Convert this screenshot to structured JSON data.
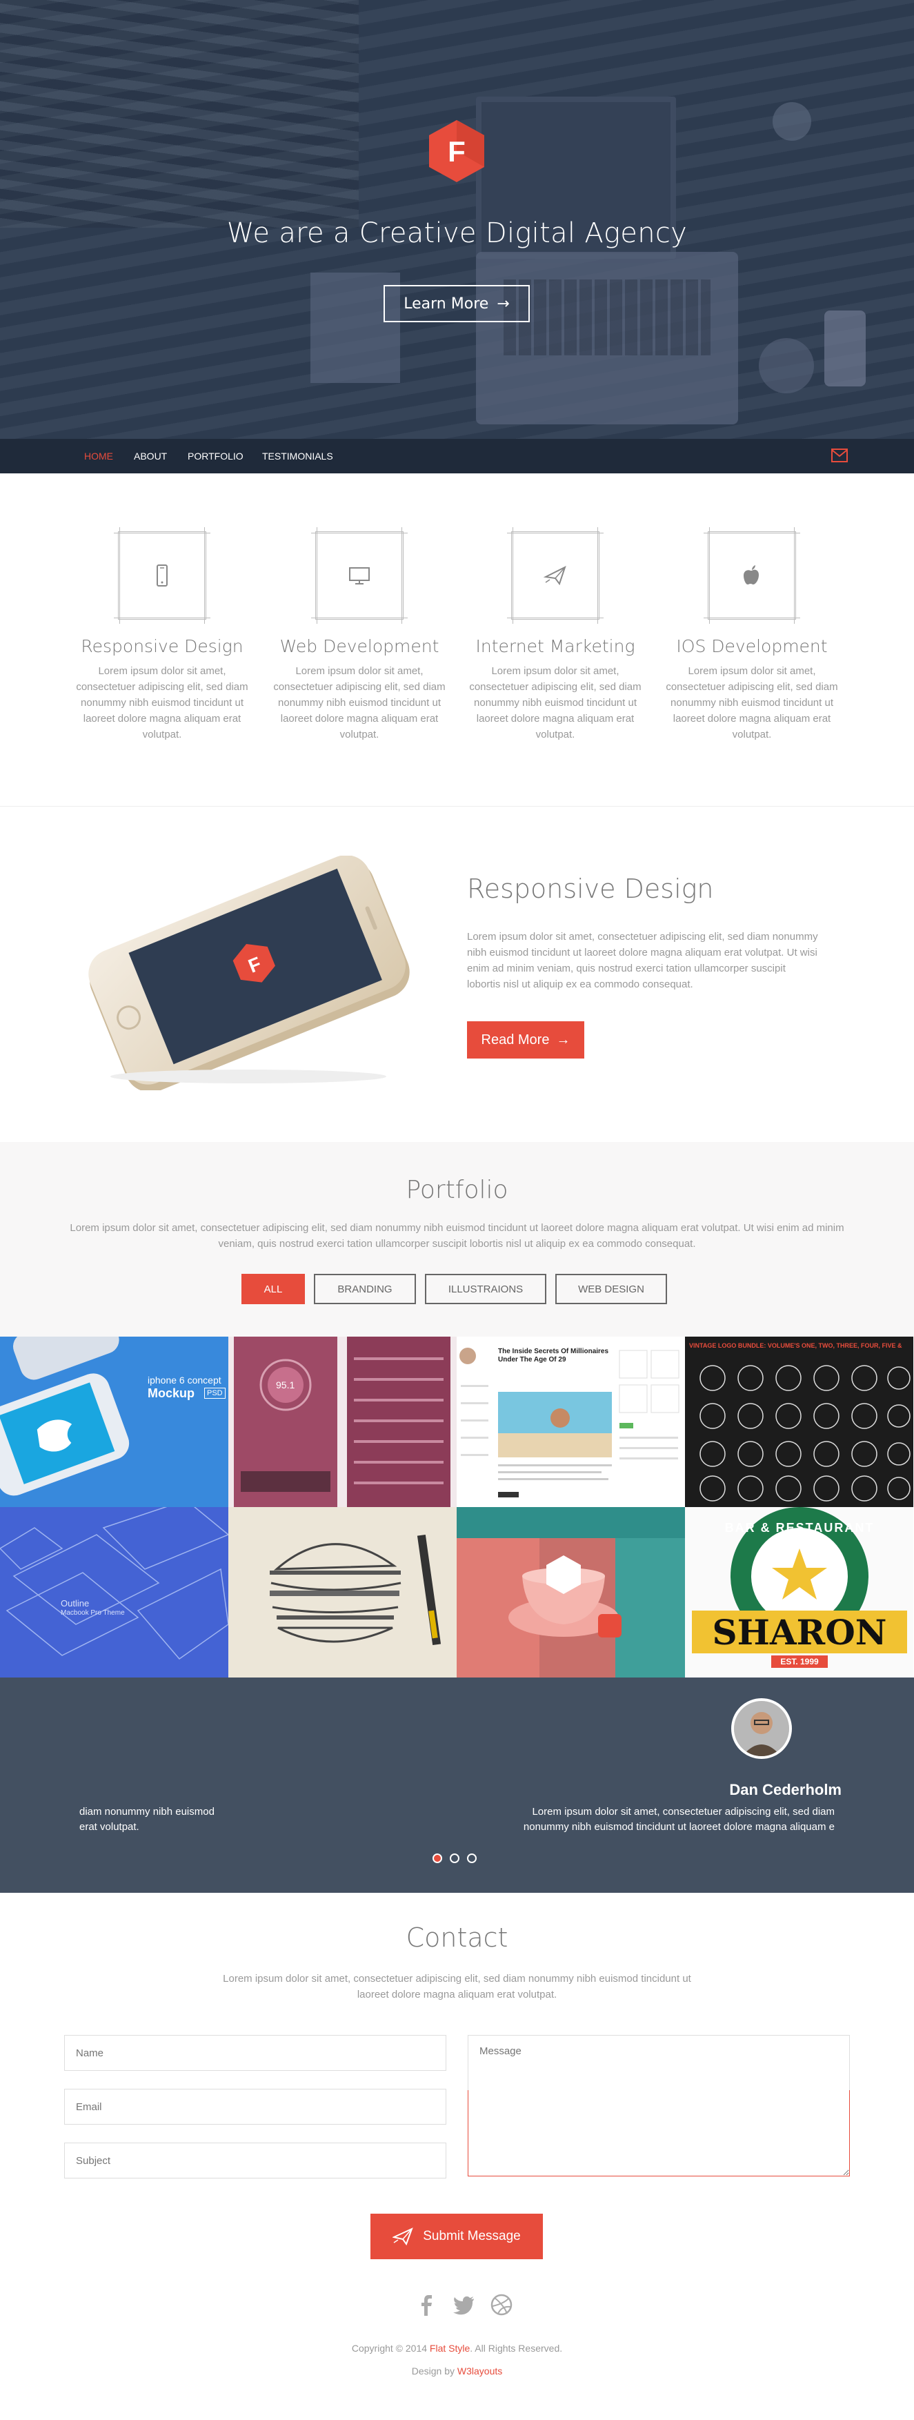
{
  "hero": {
    "logo_letter": "F",
    "title": "We are a Creative Digital Agency",
    "button_label": "Learn More",
    "button_arrow": "→"
  },
  "nav": {
    "items": [
      "HOME",
      "ABOUT",
      "PORTFOLIO",
      "TESTIMONIALS"
    ],
    "active": "HOME",
    "mail_icon": "envelope-icon"
  },
  "services": [
    {
      "icon": "mobile-phone-icon",
      "title": "Responsive Design",
      "text": "Lorem ipsum dolor sit amet, consectetuer adipiscing elit, sed diam nonummy nibh euismod tincidunt ut laoreet dolore magna aliquam erat volutpat."
    },
    {
      "icon": "monitor-icon",
      "title": "Web Development",
      "text": "Lorem ipsum dolor sit amet, consectetuer adipiscing elit, sed diam nonummy nibh euismod tincidunt ut laoreet dolore magna aliquam erat volutpat."
    },
    {
      "icon": "paper-plane-icon",
      "title": "Internet Marketing",
      "text": "Lorem ipsum dolor sit amet, consectetuer adipiscing elit, sed diam nonummy nibh euismod tincidunt ut laoreet dolore magna aliquam erat volutpat."
    },
    {
      "icon": "apple-icon",
      "title": "IOS Development",
      "text": "Lorem ipsum dolor sit amet, consectetuer adipiscing elit, sed diam nonummy nibh euismod tincidunt ut laoreet dolore magna aliquam erat volutpat."
    }
  ],
  "responsive": {
    "title": "Responsive Design",
    "text": "Lorem ipsum dolor sit amet, consectetuer adipiscing elit, sed diam nonummy nibh euismod tincidunt ut laoreet dolore magna aliquam erat volutpat. Ut wisi enim ad minim veniam, quis nostrud exerci tation ullamcorper suscipit lobortis nisl ut aliquip ex ea commodo consequat.",
    "button_label": "Read More",
    "button_arrow": "→"
  },
  "portfolio": {
    "title": "Portfolio",
    "text": "Lorem ipsum dolor sit amet, consectetuer adipiscing elit, sed diam nonummy nibh euismod tincidunt ut laoreet dolore magna aliquam erat volutpat. Ut wisi enim ad minim veniam, quis nostrud exerci tation ullamcorper suscipit lobortis nisl ut aliquip ex ea commodo consequat.",
    "filters": [
      "ALL",
      "BRANDING",
      "ILLUSTRAIONS",
      "WEB DESIGN"
    ],
    "active_filter": "ALL",
    "tiles": [
      {
        "name": "iphone-mockup",
        "line1": "iphone 6 concept",
        "line2": "Mockup",
        "badge": "PSD"
      },
      {
        "name": "music-app-ui",
        "display_value": "95.1"
      },
      {
        "name": "blog-layout",
        "headline": "The Inside Secrets Of Millionaires Under The Age Of 29"
      },
      {
        "name": "vintage-logo-bundle",
        "header": "VINTAGE LOGO BUNDLE: VOLUME'S ONE, TWO, THREE, FOUR, FIVE &",
        "bottom": "SHARON"
      },
      {
        "name": "outline-mockup",
        "line1": "Outline",
        "line2": "Macbook Pro Theme"
      },
      {
        "name": "burger-sketch"
      },
      {
        "name": "teacup-illustration"
      },
      {
        "name": "bar-restaurant-logo",
        "arc": "BAR & RESTAURANT",
        "word": "SHARON",
        "est": "EST. 1999"
      }
    ]
  },
  "testimonials": {
    "name": "Dan Cederholm",
    "left_fragment_1": "diam nonummy nibh euismod",
    "left_fragment_2": "erat volutpat.",
    "quote_1": "Lorem ipsum dolor sit amet, consectetuer adipiscing elit, sed diam",
    "quote_2": "nonummy nibh euismod tincidunt ut laoreet dolore magna aliquam e",
    "dots": 3,
    "active_dot": 0
  },
  "contact": {
    "title": "Contact",
    "text": "Lorem ipsum dolor sit amet, consectetuer adipiscing elit, sed diam nonummy nibh euismod tincidunt ut laoreet dolore magna aliquam erat volutpat.",
    "name_placeholder": "Name",
    "email_placeholder": "Email",
    "subject_placeholder": "Subject",
    "message_placeholder": "Message",
    "submit_label": "Submit Message"
  },
  "footer": {
    "social": [
      "facebook-icon",
      "twitter-icon",
      "dribbble-icon"
    ],
    "copyright_prefix": "Copyright © 2014 ",
    "copyright_brand": "Flat Style",
    "copyright_suffix": ". All Rights Reserved.",
    "design_prefix": "Design by ",
    "design_brand": "W3layouts"
  },
  "colors": {
    "accent": "#e74c3c",
    "hero_overlay": "#2f3d52",
    "nav_bg": "#1f2a3a",
    "testimonial_bg": "#435061"
  }
}
